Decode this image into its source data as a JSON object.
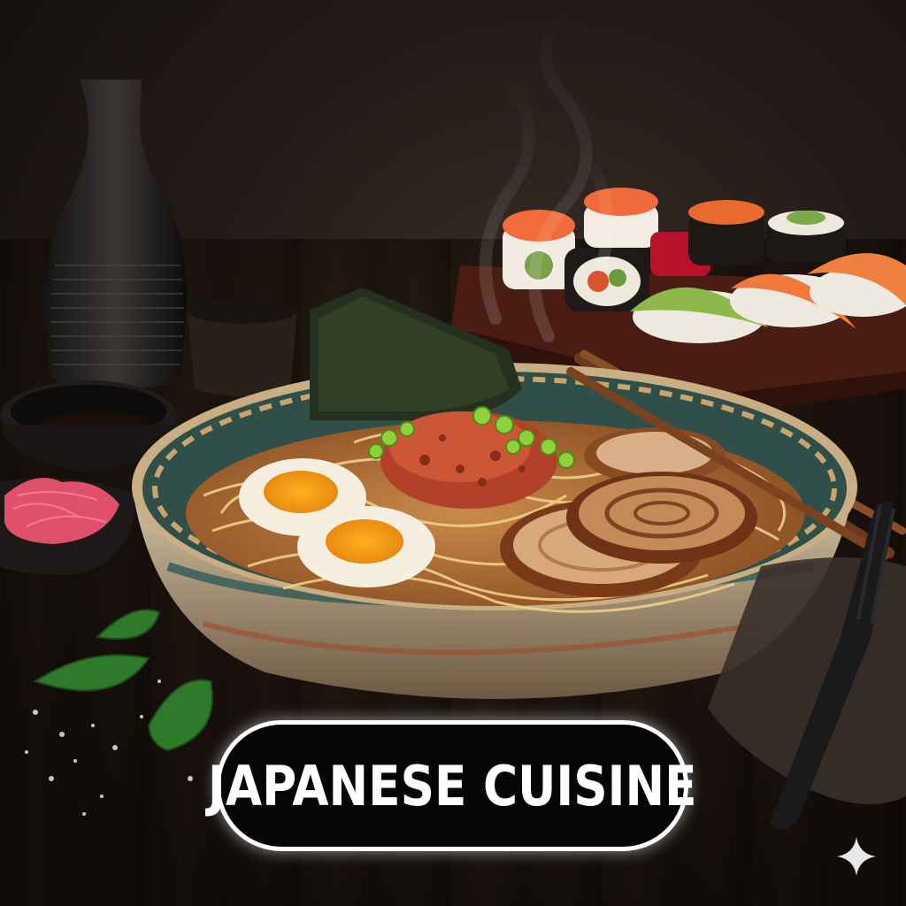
{
  "title": "JAPANESE CUISINE",
  "colors": {
    "badge_background": "#050505",
    "badge_border": "#ffffff",
    "broth": "#b8733a",
    "wood": "#2b1d15"
  },
  "icons": {
    "watermark": "sparkle-icon"
  }
}
